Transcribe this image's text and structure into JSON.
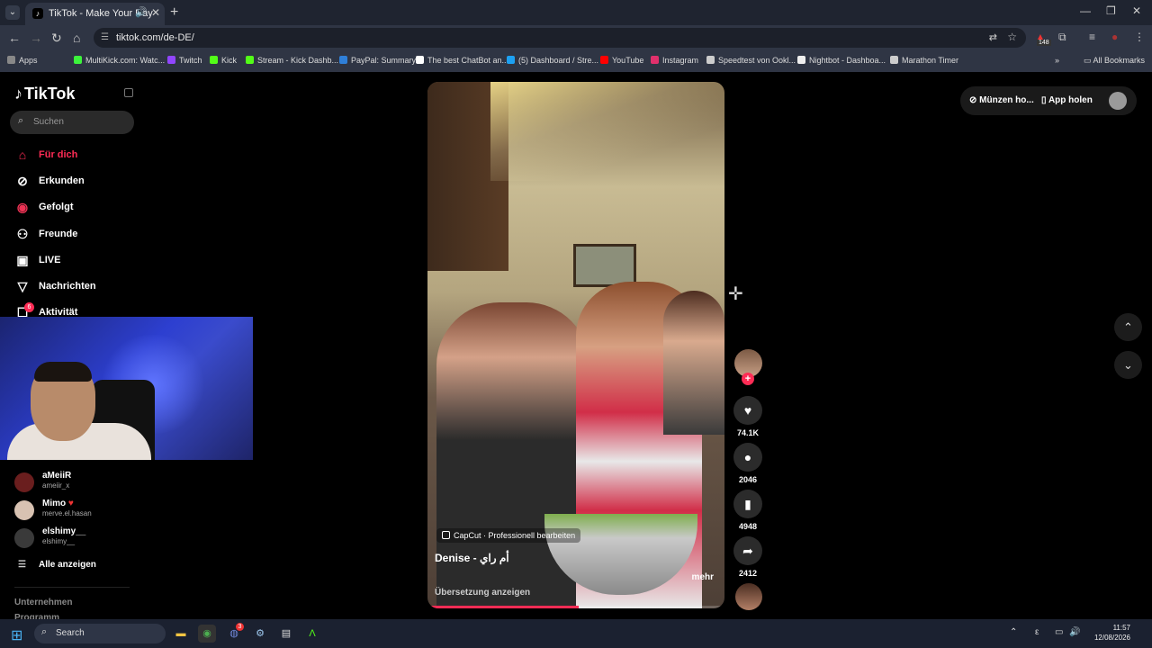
{
  "browser": {
    "tab_title": "TikTok - Make Your Day",
    "url": "tiktok.com/de-DE/",
    "extension_badge": "148",
    "bookmarks": [
      "Apps",
      "MultiKick.com: Watc...",
      "Twitch",
      "Kick",
      "Stream - Kick Dashb...",
      "PayPal: Summary",
      "The best ChatBot an...",
      "(5) Dashboard / Stre...",
      "YouTube",
      "Instagram",
      "Speedtest von Ookl...",
      "Nightbot - Dashboa...",
      "Marathon Timer"
    ],
    "all_bookmarks": "All Bookmarks",
    "bookmark_colors": [
      "#888888",
      "#3cf43c",
      "#9146ff",
      "#53fc18",
      "#53fc18",
      "#2f7fd8",
      "#ffffff",
      "#1da1f2",
      "#ff0000",
      "#e1306c",
      "#cccccc",
      "#eeeeee",
      "#cccccc"
    ]
  },
  "sidebar": {
    "logo": "TikTok",
    "search_placeholder": "Suchen",
    "nav": [
      {
        "label": "Für dich",
        "icon": "home-icon"
      },
      {
        "label": "Erkunden",
        "icon": "compass-icon"
      },
      {
        "label": "Gefolgt",
        "icon": "following-icon"
      },
      {
        "label": "Freunde",
        "icon": "friends-icon"
      },
      {
        "label": "LIVE",
        "icon": "live-icon"
      },
      {
        "label": "Nachrichten",
        "icon": "messages-icon"
      },
      {
        "label": "Aktivität",
        "icon": "activity-icon"
      }
    ],
    "activity_badge": "6",
    "accounts": [
      {
        "name": "aMeiiR",
        "handle": "ameiir_x"
      },
      {
        "name": "Mimo",
        "handle": "merve.el.hasan"
      },
      {
        "name": "elshimy__",
        "handle": "elshimy__"
      }
    ],
    "show_all": "Alle anzeigen",
    "footer": [
      "Unternehmen",
      "Programm"
    ]
  },
  "video": {
    "capcut_label": "CapCut · Professionell bearbeiten",
    "author": "Denise - أم راي",
    "more": "mehr",
    "translate": "Übersetzung anzeigen",
    "progress": 0.51
  },
  "actions": {
    "likes": "74.1K",
    "comments": "2046",
    "saves": "4948",
    "shares": "2412"
  },
  "top_right": {
    "coins": "Münzen ho...",
    "app": "App holen"
  },
  "taskbar": {
    "search": "Search",
    "time": "11:57",
    "date": "12/08/2026",
    "lang": "ε",
    "discord_badge": "3"
  },
  "colors": {
    "accent": "#fe2c55",
    "browser_bg": "#2f3544",
    "taskbar_bg": "#1b2130"
  }
}
